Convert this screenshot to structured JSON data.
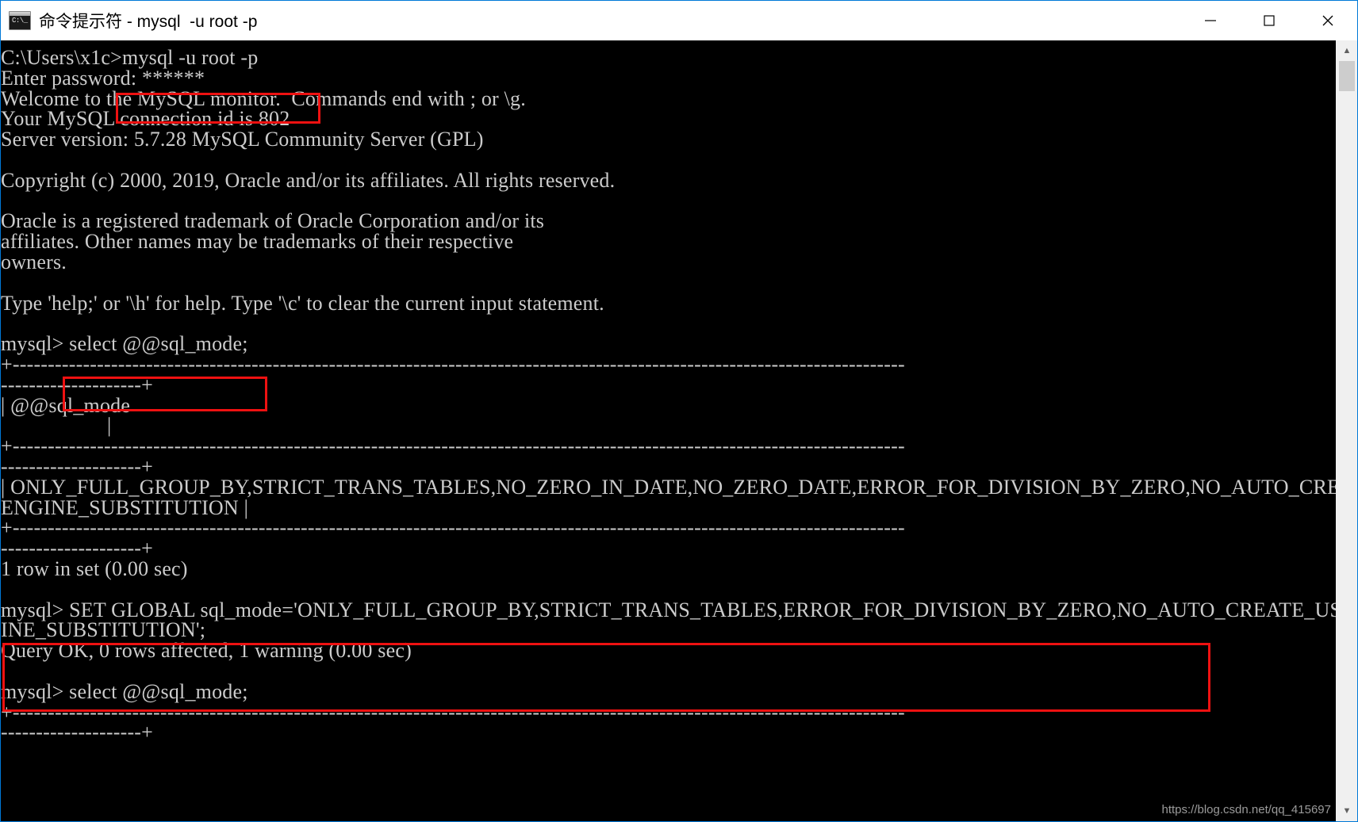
{
  "window": {
    "title": "命令提示符 - mysql  -u root -p",
    "icon_name": "cmd-icon",
    "icon_prompt": "C:\\_",
    "minimize_label": "Minimize",
    "maximize_label": "Maximize",
    "close_label": "Close"
  },
  "console": {
    "lines": [
      "C:\\Users\\x1c>mysql -u root -p",
      "Enter password: ******",
      "Welcome to the MySQL monitor.  Commands end with ; or \\g.",
      "Your MySQL connection id is 802",
      "Server version: 5.7.28 MySQL Community Server (GPL)",
      "",
      "Copyright (c) 2000, 2019, Oracle and/or its affiliates. All rights reserved.",
      "",
      "Oracle is a registered trademark of Oracle Corporation and/or its",
      "affiliates. Other names may be trademarks of their respective",
      "owners.",
      "",
      "Type 'help;' or '\\h' for help. Type '\\c' to clear the current input statement.",
      "",
      "mysql> select @@sql_mode;",
      "+-------------------------------------------------------------------------------------------------------------------------------",
      "--------------------+",
      "| @@sql_mode",
      "                    |",
      "+-------------------------------------------------------------------------------------------------------------------------------",
      "--------------------+",
      "| ONLY_FULL_GROUP_BY,STRICT_TRANS_TABLES,NO_ZERO_IN_DATE,NO_ZERO_DATE,ERROR_FOR_DIVISION_BY_ZERO,NO_AUTO_CREATE_USER,NO_",
      "ENGINE_SUBSTITUTION |",
      "+-------------------------------------------------------------------------------------------------------------------------------",
      "--------------------+",
      "1 row in set (0.00 sec)",
      "",
      "mysql> SET GLOBAL sql_mode='ONLY_FULL_GROUP_BY,STRICT_TRANS_TABLES,ERROR_FOR_DIVISION_BY_ZERO,NO_AUTO_CREATE_USER,NO_ENG",
      "INE_SUBSTITUTION';",
      "Query OK, 0 rows affected, 1 warning (0.00 sec)",
      "",
      "mysql> select @@sql_mode;",
      "+-------------------------------------------------------------------------------------------------------------------------------",
      "--------------------+"
    ]
  },
  "annotations": {
    "box_color": "#ee1111",
    "box_1_target": "mysql -u root -p",
    "box_2_target": "select @@sql_mode;",
    "box_3_target": "SET GLOBAL sql_mode=...; Query OK, 0 rows affected, 1 warning (0.00 sec)"
  },
  "watermark": {
    "text": "https://blog.csdn.net/qq_415697"
  },
  "scrollbar": {
    "up_arrow": "▲",
    "down_arrow": "▼"
  },
  "colors": {
    "console_bg": "#000000",
    "console_fg": "#cccccc",
    "window_border": "#0078d7",
    "annotation": "#ee1111"
  }
}
